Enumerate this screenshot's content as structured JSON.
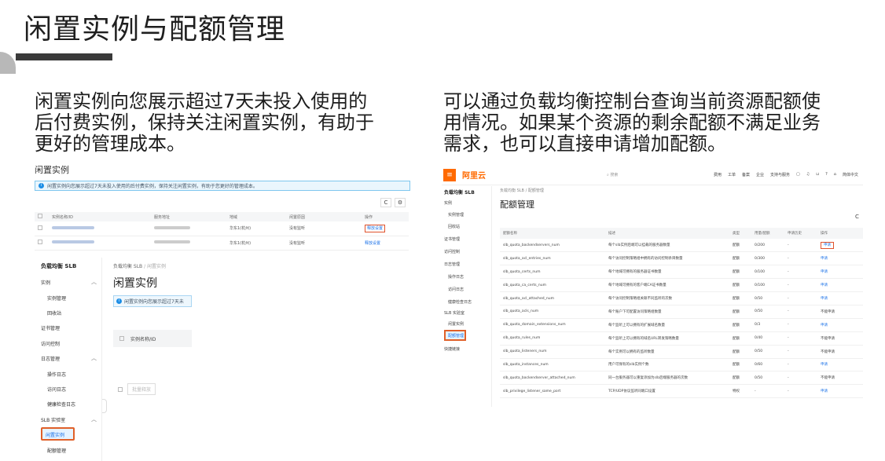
{
  "slide": {
    "title": "闲置实例与配额管理",
    "left_text": "闲置实例向您展示超过7天未投入使用的后付费实例，保持关注闲置实例，有助于更好的管理成本。",
    "right_text": "可以通过负载均衡控制台查询当前资源配额使用情况。如果某个资源的剩余配额不满足业务需求，也可以直接申请增加配额。"
  },
  "idle_screenshot": {
    "page_title": "闲置实例",
    "notice": "闲置实例向您展示超过7天未投入使用的后付费实例，保持关注闲置实例，有助于您更好的管理成本。",
    "tools": {
      "refresh": "C",
      "settings": "⚙"
    },
    "columns": [
      "实例名称/ID",
      "服务地址",
      "地域",
      "闲置原因",
      "操作"
    ],
    "rows": [
      {
        "region": "华东1(杭州)",
        "reason": "没有监听",
        "action": "释放设置"
      },
      {
        "region": "华东1(杭州)",
        "reason": "没有监听",
        "action": "释放设置"
      }
    ]
  },
  "idle_zoom": {
    "sidebar_title": "负载均衡 SLB",
    "sidebar_items": [
      "实例",
      "实例管理",
      "回收站",
      "证书管理",
      "访问控制",
      "日志管理",
      "操作日志",
      "访问日志",
      "健康检查日志",
      "SLB 实验室",
      "闲置实例",
      "配额管理"
    ],
    "breadcrumb_root": "负载均衡 SLB",
    "breadcrumb_current": "闲置实例",
    "title": "闲置实例",
    "notice": "闲置实例向您展示超过7天未",
    "column_name": "实例名称/ID",
    "batch_label": "批量释放"
  },
  "quota_screenshot": {
    "logo": "阿里云",
    "search_placeholder": "搜索",
    "topnav": [
      "费用",
      "工单",
      "备案",
      "企业",
      "支持与服务",
      "简体中文"
    ],
    "sidebar_title": "负载均衡 SLB",
    "sidebar_items": [
      "实例",
      "实例管理",
      "回收站",
      "证书管理",
      "访问控制",
      "日志管理",
      "操作日志",
      "访问日志",
      "健康检查日志",
      "SLB 实验室",
      "闲置实例",
      "配额管理",
      "快捷链接"
    ],
    "breadcrumb": "负载均衡 SLB / 配额管理",
    "title": "配额管理",
    "refresh": "C",
    "columns": [
      "配额名称",
      "描述",
      "类型",
      "用量/配额",
      "申请历史",
      "操作"
    ],
    "rows": [
      {
        "name": "slb_quota_backendservers_num",
        "desc": "每个slb实例后端可以挂载的服务器数量",
        "type": "配额",
        "usage": "0/200",
        "history": "-",
        "action": "申请"
      },
      {
        "name": "slb_quota_acl_entries_num",
        "desc": "每个访问控制策略组中拥有的访问控制条目数量",
        "type": "配额",
        "usage": "0/300",
        "history": "-",
        "action": "申请"
      },
      {
        "name": "slb_quota_certs_num",
        "desc": "每个地域可拥有的服务器证书数量",
        "type": "配额",
        "usage": "0/100",
        "history": "-",
        "action": "申请"
      },
      {
        "name": "slb_quota_ca_certs_num",
        "desc": "每个地域可拥有的客户端CA证书数量",
        "type": "配额",
        "usage": "0/100",
        "history": "-",
        "action": "申请"
      },
      {
        "name": "slb_quota_acl_attached_num",
        "desc": "每个访问控制策略组关联不同监听的次数",
        "type": "配额",
        "usage": "0/50",
        "history": "-",
        "action": "申请"
      },
      {
        "name": "slb_quota_acls_num",
        "desc": "每个账户下可配置访问策略组数量",
        "type": "配额",
        "usage": "0/50",
        "history": "-",
        "action": "不能申请"
      },
      {
        "name": "slb_quota_domain_extensions_num",
        "desc": "每个监听上可以拥有的扩展域名数量",
        "type": "配额",
        "usage": "0/3",
        "history": "-",
        "action": "申请"
      },
      {
        "name": "slb_quota_rules_num",
        "desc": "每个监听上可以拥有的域名URL转发策略数量",
        "type": "配额",
        "usage": "0/40",
        "history": "-",
        "action": "不能申请"
      },
      {
        "name": "slb_quota_listeners_num",
        "desc": "每个实例可以拥有的监听数量",
        "type": "配额",
        "usage": "0/50",
        "history": "-",
        "action": "不能申请"
      },
      {
        "name": "slb_quota_instances_num",
        "desc": "用户可保有的slb实例个数",
        "type": "配额",
        "usage": "0/60",
        "history": "-",
        "action": "申请"
      },
      {
        "name": "slb_quota_backendserver_attached_num",
        "desc": "同一台服务器可以重复添加为slb后端服务器的次数",
        "type": "配额",
        "usage": "0/50",
        "history": "-",
        "action": "不能申请"
      },
      {
        "name": "slb_privilege_listener_same_port",
        "desc": "TCP/UDP协议监听同端口设置",
        "type": "特权",
        "usage": "-",
        "history": "-",
        "action": "申请"
      }
    ],
    "highlight_color": "#e0522c",
    "accent_color": "#ff6a00"
  }
}
